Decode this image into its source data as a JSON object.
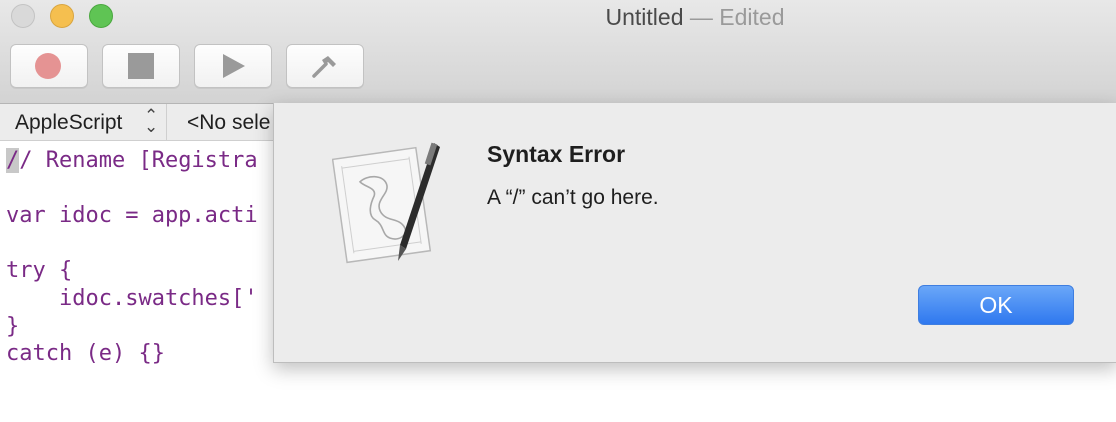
{
  "window": {
    "title": "Untitled",
    "title_separator": "—",
    "status": "Edited"
  },
  "toolbar": {
    "record_icon": "record-circle-icon",
    "stop_icon": "stop-square-icon",
    "run_icon": "play-triangle-icon",
    "compile_icon": "hammer-icon"
  },
  "navbar": {
    "language": "AppleScript",
    "selection": "<No sele"
  },
  "editor": {
    "lines": [
      "/ Rename [Registra",
      "",
      "var idoc = app.acti",
      "",
      "try {",
      "    idoc.swatches['",
      "}",
      "catch (e) {}"
    ],
    "first_char": "/"
  },
  "alert": {
    "title": "Syntax Error",
    "message": "A “/” can’t go here.",
    "ok_label": "OK",
    "icon": "script-editor-app-icon"
  },
  "colors": {
    "code_text": "#7a2a86",
    "ok_button": "#2f78ef",
    "traffic_min": "#f5bf4f",
    "traffic_max": "#5fc454"
  }
}
